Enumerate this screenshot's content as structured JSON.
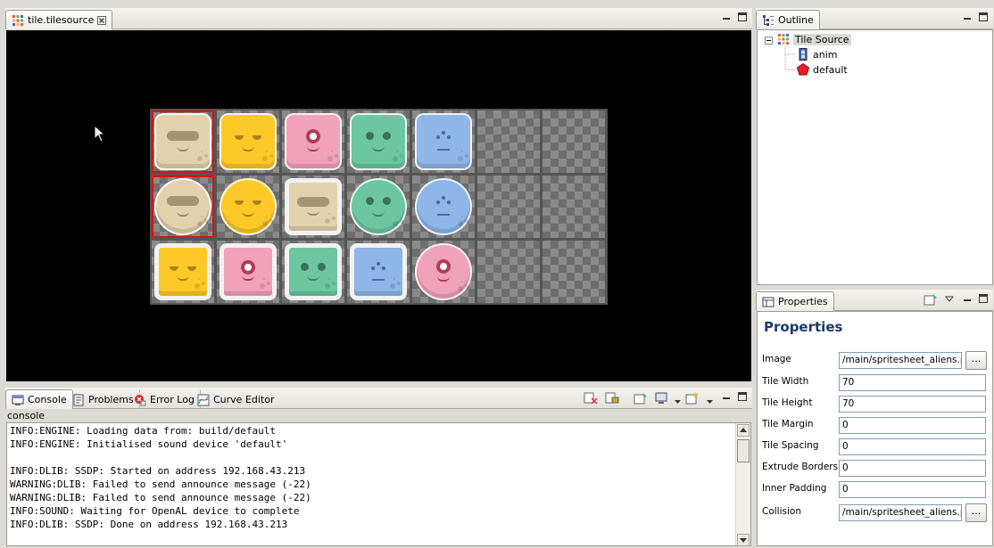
{
  "editor": {
    "tab_label": "tile.tilesource",
    "tile_grid": [
      [
        {
          "alien": "beige",
          "shape": "square",
          "selected": true
        },
        {
          "alien": "yellow",
          "shape": "square"
        },
        {
          "alien": "pink",
          "shape": "square"
        },
        {
          "alien": "green",
          "shape": "square"
        },
        {
          "alien": "blue",
          "shape": "square"
        },
        {
          "alien": "empty"
        },
        {
          "alien": "empty"
        }
      ],
      [
        {
          "alien": "beige",
          "shape": "round",
          "selected": true
        },
        {
          "alien": "yellow",
          "shape": "round"
        },
        {
          "alien": "beige",
          "shape": "box"
        },
        {
          "alien": "green",
          "shape": "round"
        },
        {
          "alien": "blue",
          "shape": "round"
        },
        {
          "alien": "empty"
        },
        {
          "alien": "empty"
        }
      ],
      [
        {
          "alien": "yellow",
          "shape": "box"
        },
        {
          "alien": "pink",
          "shape": "box"
        },
        {
          "alien": "green",
          "shape": "box"
        },
        {
          "alien": "blue",
          "shape": "box"
        },
        {
          "alien": "pink",
          "shape": "round"
        },
        {
          "alien": "empty"
        },
        {
          "alien": "empty"
        }
      ]
    ],
    "alien_colors": {
      "beige": "#e3d1ad",
      "yellow": "#fdc928",
      "pink": "#f0a2bb",
      "green": "#6cc6a2",
      "blue": "#8fb6e8"
    }
  },
  "bottom_panel": {
    "tabs": [
      {
        "label": "Console",
        "icon": "console-icon"
      },
      {
        "label": "Problems",
        "icon": "problems-icon"
      },
      {
        "label": "Error Log",
        "icon": "error-log-icon"
      },
      {
        "label": "Curve Editor",
        "icon": "curve-editor-icon"
      }
    ],
    "console_title": "console",
    "console_lines": [
      "INFO:ENGINE: Loading data from: build/default",
      "INFO:ENGINE: Initialised sound device 'default'",
      "",
      "INFO:DLIB: SSDP: Started on address 192.168.43.213",
      "WARNING:DLIB: Failed to send announce message (-22)",
      "WARNING:DLIB: Failed to send announce message (-22)",
      "INFO:SOUND: Waiting for OpenAL device to complete",
      "INFO:DLIB: SSDP: Done on address 192.168.43.213"
    ]
  },
  "outline": {
    "tab_label": "Outline",
    "root": "Tile Source",
    "children": [
      "anim",
      "default"
    ]
  },
  "properties": {
    "tab_label": "Properties",
    "heading": "Properties",
    "browse_label": "...",
    "fields": [
      {
        "label": "Image",
        "value": "/main/spritesheet_aliens.pn",
        "browse": true
      },
      {
        "label": "Tile Width",
        "value": "70"
      },
      {
        "label": "Tile Height",
        "value": "70"
      },
      {
        "label": "Tile Margin",
        "value": "0"
      },
      {
        "label": "Tile Spacing",
        "value": "0"
      },
      {
        "label": "Extrude Borders",
        "value": "0"
      },
      {
        "label": "Inner Padding",
        "value": "0"
      },
      {
        "label": "Collision",
        "value": "/main/spritesheet_aliens.pn",
        "browse": true
      }
    ]
  }
}
